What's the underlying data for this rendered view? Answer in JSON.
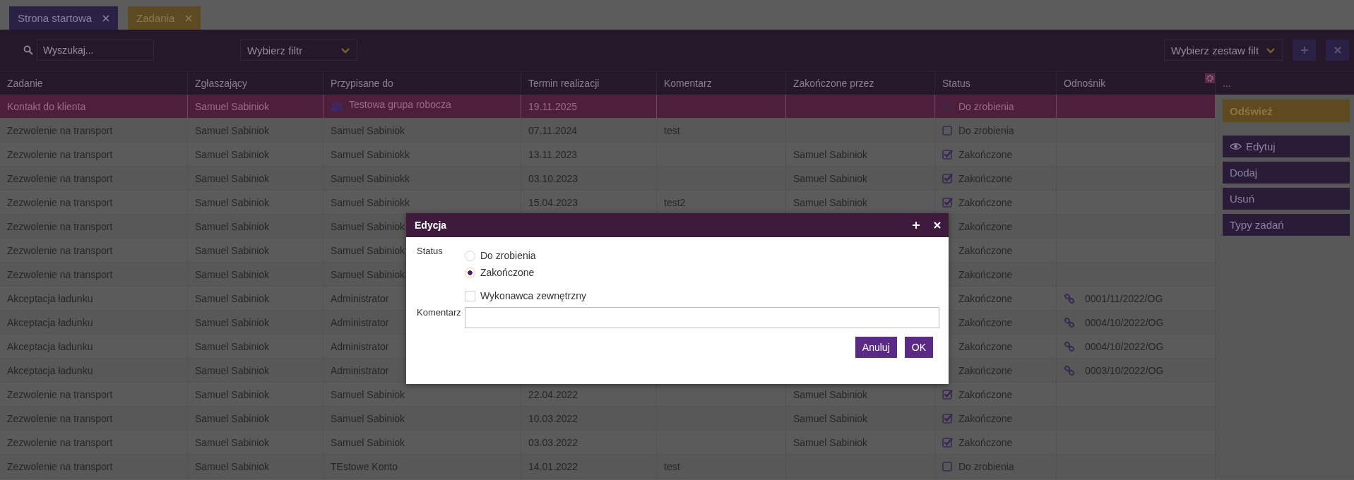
{
  "tabs": [
    {
      "label": "Strona startowa",
      "selected": false
    },
    {
      "label": "Zadania",
      "selected": true
    }
  ],
  "toolbar": {
    "search": {
      "placeholder": "Wyszukaj..."
    },
    "filter": {
      "value": "Wybierz filtr"
    },
    "filter_set": {
      "value": "Wybierz zestaw filt"
    }
  },
  "table": {
    "columns": [
      "Zadanie",
      "Zgłaszający",
      "Przypisane do",
      "Termin realizacji",
      "Komentarz",
      "Zakończone przez",
      "Status",
      "Odnośnik",
      "..."
    ],
    "rows": [
      {
        "selected": true,
        "task": "Kontakt do klienta",
        "reporter": "Samuel Sabiniok",
        "assignee": "Testowa grupa robocza",
        "assignee_group": true,
        "due": "19.11.2025",
        "status": {
          "label": "Do zrobienia",
          "checked": false
        }
      },
      {
        "selected": false,
        "task": "Zezwolenie na transport",
        "reporter": "Samuel Sabiniok",
        "assignee": "Samuel Sabiniok",
        "assignee_group": false,
        "due": "07.11.2024",
        "comment": "test",
        "status": {
          "label": "Do zrobienia",
          "checked": false
        }
      },
      {
        "selected": false,
        "task": "Zezwolenie na transport",
        "reporter": "Samuel Sabiniok",
        "assignee": "Samuel Sabiniokk",
        "assignee_group": false,
        "due": "13.11.2023",
        "completed_by": "Samuel Sabiniok",
        "status": {
          "label": "Zakończone",
          "checked": true
        }
      },
      {
        "selected": false,
        "task": "Zezwolenie na transport",
        "reporter": "Samuel Sabiniok",
        "assignee": "Samuel Sabiniokk",
        "assignee_group": false,
        "due": "03.10.2023",
        "completed_by": "Samuel Sabiniok",
        "status": {
          "label": "Zakończone",
          "checked": true
        }
      },
      {
        "selected": false,
        "task": "Zezwolenie na transport",
        "reporter": "Samuel Sabiniok",
        "assignee": "Samuel Sabiniokk",
        "assignee_group": false,
        "due": "15.04.2023",
        "comment": "test2",
        "completed_by": "Samuel Sabiniok",
        "status": {
          "label": "Zakończone",
          "checked": true
        }
      },
      {
        "selected": false,
        "task": "Zezwolenie na transport",
        "reporter": "Samuel Sabiniok",
        "assignee": "Samuel Sabiniok",
        "assignee_group": false,
        "status": {
          "label": "Zakończone"
        }
      },
      {
        "selected": false,
        "task": "Zezwolenie na transport",
        "reporter": "Samuel Sabiniok",
        "assignee": "Samuel Sabiniok",
        "assignee_group": false,
        "status": {
          "label": "Zakończone"
        }
      },
      {
        "selected": false,
        "task": "Zezwolenie na transport",
        "reporter": "Samuel Sabiniok",
        "assignee": "Samuel Sabiniok",
        "assignee_group": false,
        "status": {
          "label": "Zakończone"
        }
      },
      {
        "selected": false,
        "task": "Akceptacja ładunku",
        "reporter": "Samuel Sabiniok",
        "assignee": "Administrator",
        "assignee_group": false,
        "status": {
          "label": "Zakończone"
        },
        "link": "0001/11/2022/OG"
      },
      {
        "selected": false,
        "task": "Akceptacja ładunku",
        "reporter": "Samuel Sabiniok",
        "assignee": "Administrator",
        "assignee_group": false,
        "status": {
          "label": "Zakończone"
        },
        "link": "0004/10/2022/OG"
      },
      {
        "selected": false,
        "task": "Akceptacja ładunku",
        "reporter": "Samuel Sabiniok",
        "assignee": "Administrator",
        "assignee_group": false,
        "status": {
          "label": "Zakończone"
        },
        "link": "0004/10/2022/OG"
      },
      {
        "selected": false,
        "task": "Akceptacja ładunku",
        "reporter": "Samuel Sabiniok",
        "assignee": "Administrator",
        "assignee_group": false,
        "status": {
          "label": "Zakończone"
        },
        "link": "0003/10/2022/OG"
      },
      {
        "selected": false,
        "task": "Zezwolenie na transport",
        "reporter": "Samuel Sabiniok",
        "assignee": "Samuel Sabiniok",
        "assignee_group": false,
        "due": "22.04.2022",
        "completed_by": "Samuel Sabiniok",
        "status": {
          "label": "Zakończone",
          "checked": true
        }
      },
      {
        "selected": false,
        "task": "Zezwolenie na transport",
        "reporter": "Samuel Sabiniok",
        "assignee": "Samuel Sabiniok",
        "assignee_group": false,
        "due": "10.03.2022",
        "completed_by": "Samuel Sabiniok",
        "status": {
          "label": "Zakończone",
          "checked": true
        }
      },
      {
        "selected": false,
        "task": "Zezwolenie na transport",
        "reporter": "Samuel Sabiniok",
        "assignee": "Samuel Sabiniok",
        "assignee_group": false,
        "due": "03.03.2022",
        "completed_by": "Samuel Sabiniok",
        "status": {
          "label": "Zakończone",
          "checked": true
        }
      },
      {
        "selected": false,
        "task": "Zezwolenie na transport",
        "reporter": "Samuel Sabiniok",
        "assignee": "TEstowe Konto",
        "assignee_group": false,
        "due": "14.01.2022",
        "comment": "test",
        "status": {
          "label": "Do zrobienia",
          "checked": false
        }
      }
    ]
  },
  "side_panel": {
    "buttons": [
      {
        "label": "Odśwież",
        "kind": "accent"
      },
      {
        "label": "Edytuj",
        "kind": "eye"
      },
      {
        "label": "Dodaj",
        "kind": "plain"
      },
      {
        "label": "Usuń",
        "kind": "plain"
      },
      {
        "label": "Typy zadań",
        "kind": "plain"
      }
    ]
  },
  "dialog": {
    "title": "Edycja",
    "status_label": "Status",
    "options": [
      {
        "label": "Do zrobienia",
        "selected": false
      },
      {
        "label": "Zakończone",
        "selected": true
      }
    ],
    "external": {
      "label": "Wykonawca zewnętrzny",
      "checked": false
    },
    "comment_label": "Komentarz",
    "buttons": [
      "Anuluj",
      "OK"
    ]
  }
}
